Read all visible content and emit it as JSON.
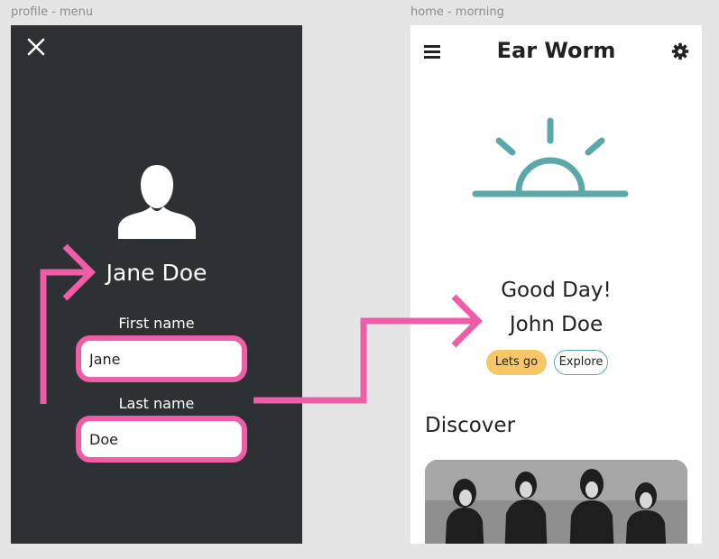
{
  "frames": {
    "profile_label": "profile - menu",
    "home_label": "home - morning"
  },
  "profile": {
    "close_icon": "close-icon",
    "avatar_icon": "user-silhouette-icon",
    "name": "Jane Doe",
    "first_name_label": "First name",
    "first_name_value": "Jane",
    "last_name_label": "Last name",
    "last_name_value": "Doe"
  },
  "home": {
    "menu_icon": "hamburger-icon",
    "app_title": "Ear Worm",
    "settings_icon": "gear-icon",
    "sun_icon": "sunrise-icon",
    "greeting_line1": "Good Day!",
    "greeting_line2": "John Doe",
    "lets_go_label": "Lets go",
    "explore_label": "Explore",
    "discover_heading": "Discover"
  },
  "colors": {
    "profile_bg": "#2d3134",
    "accent_pink": "#ef5da8",
    "sun_teal": "#5aa8aa",
    "pill_yellow": "#f7c766",
    "canvas_bg": "#e5e5e5"
  }
}
